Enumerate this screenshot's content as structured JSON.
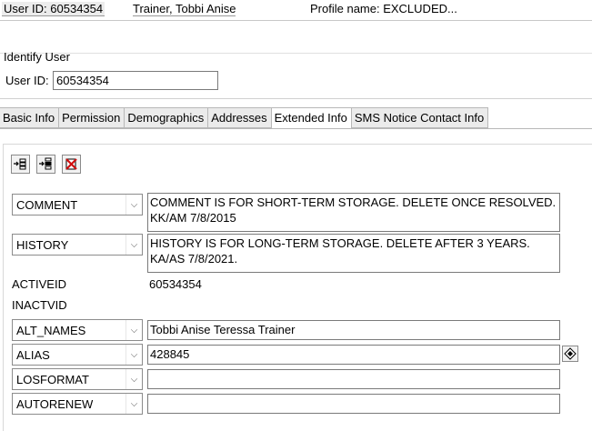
{
  "header": {
    "user_id": "User ID: 60534354",
    "user_name": "Trainer, Tobbi Anise",
    "profile": "Profile name: EXCLUDED..."
  },
  "identify": {
    "section_title": "Identify User",
    "user_id_label": "User ID:",
    "user_id_value": "60534354"
  },
  "tabs": [
    {
      "label": "Basic Info"
    },
    {
      "label": "Permission"
    },
    {
      "label": "Demographics"
    },
    {
      "label": "Addresses"
    },
    {
      "label": "Extended Info",
      "active": true
    },
    {
      "label": "SMS Notice Contact Info"
    }
  ],
  "toolbar": {
    "icons": [
      "add-row-icon",
      "insert-row-icon",
      "delete-row-icon"
    ]
  },
  "extended": {
    "comment": {
      "key": "COMMENT",
      "value": "COMMENT IS FOR SHORT-TERM STORAGE. DELETE ONCE RESOLVED. KK/AM 7/8/2015"
    },
    "history": {
      "key": "HISTORY",
      "value": "HISTORY IS FOR LONG-TERM STORAGE. DELETE AFTER 3 YEARS. KA/AS 7/8/2021."
    },
    "activeid": {
      "label": "ACTIVEID",
      "value": "60534354"
    },
    "inactvid": {
      "label": "INACTVID"
    },
    "alt_names": {
      "key": "ALT_NAMES",
      "value": "Tobbi Anise Teressa Trainer"
    },
    "alias": {
      "key": "ALIAS",
      "value": "428845"
    },
    "losformat": {
      "key": "LOSFORMAT",
      "value": ""
    },
    "autorenew": {
      "key": "AUTORENEW",
      "value": ""
    }
  }
}
